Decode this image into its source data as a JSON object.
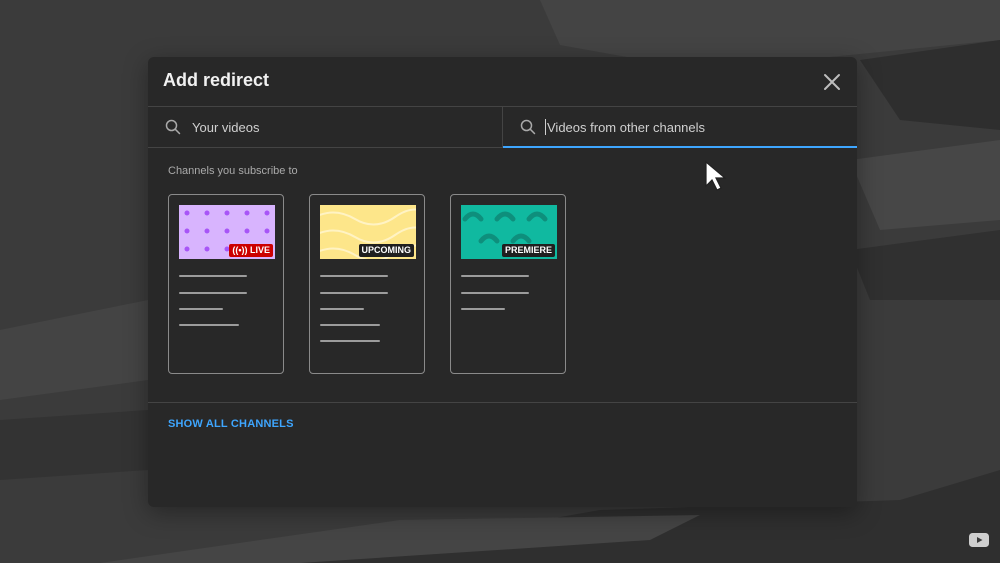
{
  "dialog": {
    "title": "Add redirect",
    "close_icon": "close-icon"
  },
  "search": {
    "left_label": "Your videos",
    "right_label": "Videos from other channels",
    "active_tab": "right",
    "icon": "search-icon"
  },
  "section": {
    "label": "Channels you subscribe to"
  },
  "cards": [
    {
      "badge": "LIVE",
      "badge_icon": "live-broadcast-icon",
      "thumb_color": "#d8b4fe",
      "badge_color": "#cc0000"
    },
    {
      "badge": "UPCOMING",
      "thumb_color": "#fde68a",
      "badge_color": "#1f1f1f"
    },
    {
      "badge": "PREMIERE",
      "thumb_color": "#10b9a0",
      "badge_color": "#1f1f1f"
    }
  ],
  "footer": {
    "show_all_label": "SHOW ALL CHANNELS"
  },
  "colors": {
    "accent": "#3ea6ff",
    "dialog_bg": "#282828",
    "page_bg": "#3b3b3b",
    "live": "#cc0000"
  }
}
